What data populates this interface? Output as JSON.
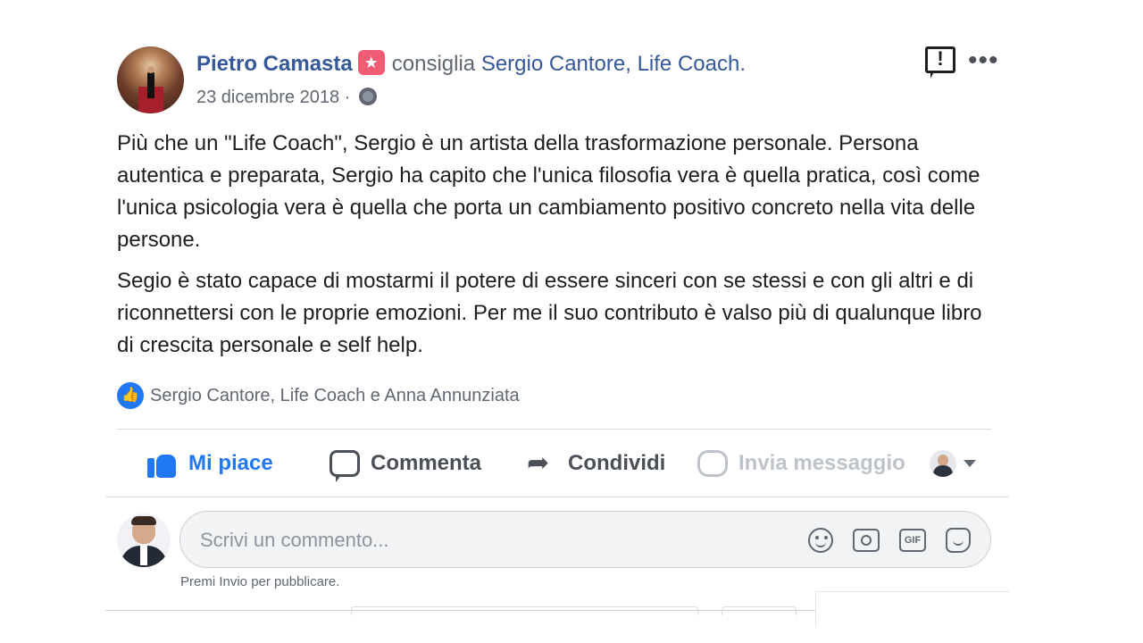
{
  "post": {
    "author": "Pietro Camasta",
    "recommends_text": "consiglia",
    "page_name": "Sergio Cantore, Life Coach.",
    "date": "23 dicembre 2018 ·",
    "paragraphs": [
      "Più che un \"Life Coach\", Sergio è un artista della trasformazione personale. Persona autentica e preparata, Sergio ha capito che l'unica filosofia vera è quella pratica, così come l'unica psicologia vera è quella che porta un cambiamento positivo concreto nella vita delle persone.",
      "Segio è stato capace di mostarmi il potere di essere sinceri con se stessi e con gli altri e di riconnettersi con le proprie emozioni. Per me il suo contributo è valso più di qualunque libro di crescita personale e self help."
    ],
    "reactions_text": "Sergio Cantore, Life Coach e Anna Annunziata"
  },
  "actions": {
    "like": "Mi piace",
    "comment": "Commenta",
    "share": "Condividi",
    "message": "Invia messaggio"
  },
  "composer": {
    "placeholder": "Scrivi un commento...",
    "gif_label": "GIF",
    "hint": "Premi Invio per pubblicare."
  },
  "icons": {
    "badge": "recommendation-star-icon",
    "report": "report-icon",
    "more": "more-options-icon",
    "privacy": "globe-icon",
    "reaction": "like-reaction-icon",
    "emoji": "emoji-icon",
    "camera": "camera-icon",
    "sticker": "sticker-icon"
  },
  "colors": {
    "link": "#365899",
    "like_blue": "#2078f4",
    "muted": "#616770",
    "recommend_badge": "#f05c73"
  }
}
